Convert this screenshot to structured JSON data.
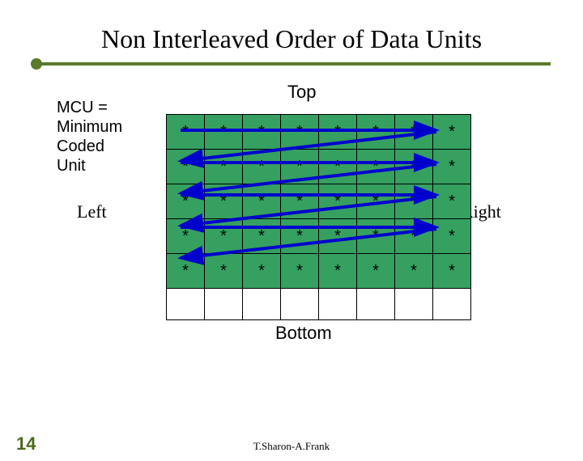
{
  "title": "Non Interleaved Order of Data Units",
  "mcu": "MCU =\nMinimum\nCoded\nUnit",
  "labels": {
    "top": "Top",
    "bottom": "Bottom",
    "left": "Left",
    "right": "Right"
  },
  "grid": {
    "rows": 5,
    "cols": 8,
    "cell_marker": "*",
    "blank_bottom_row": true
  },
  "arrow_color": "#0000cc",
  "footer": "T.Sharon-A.Frank",
  "page_number": "14"
}
